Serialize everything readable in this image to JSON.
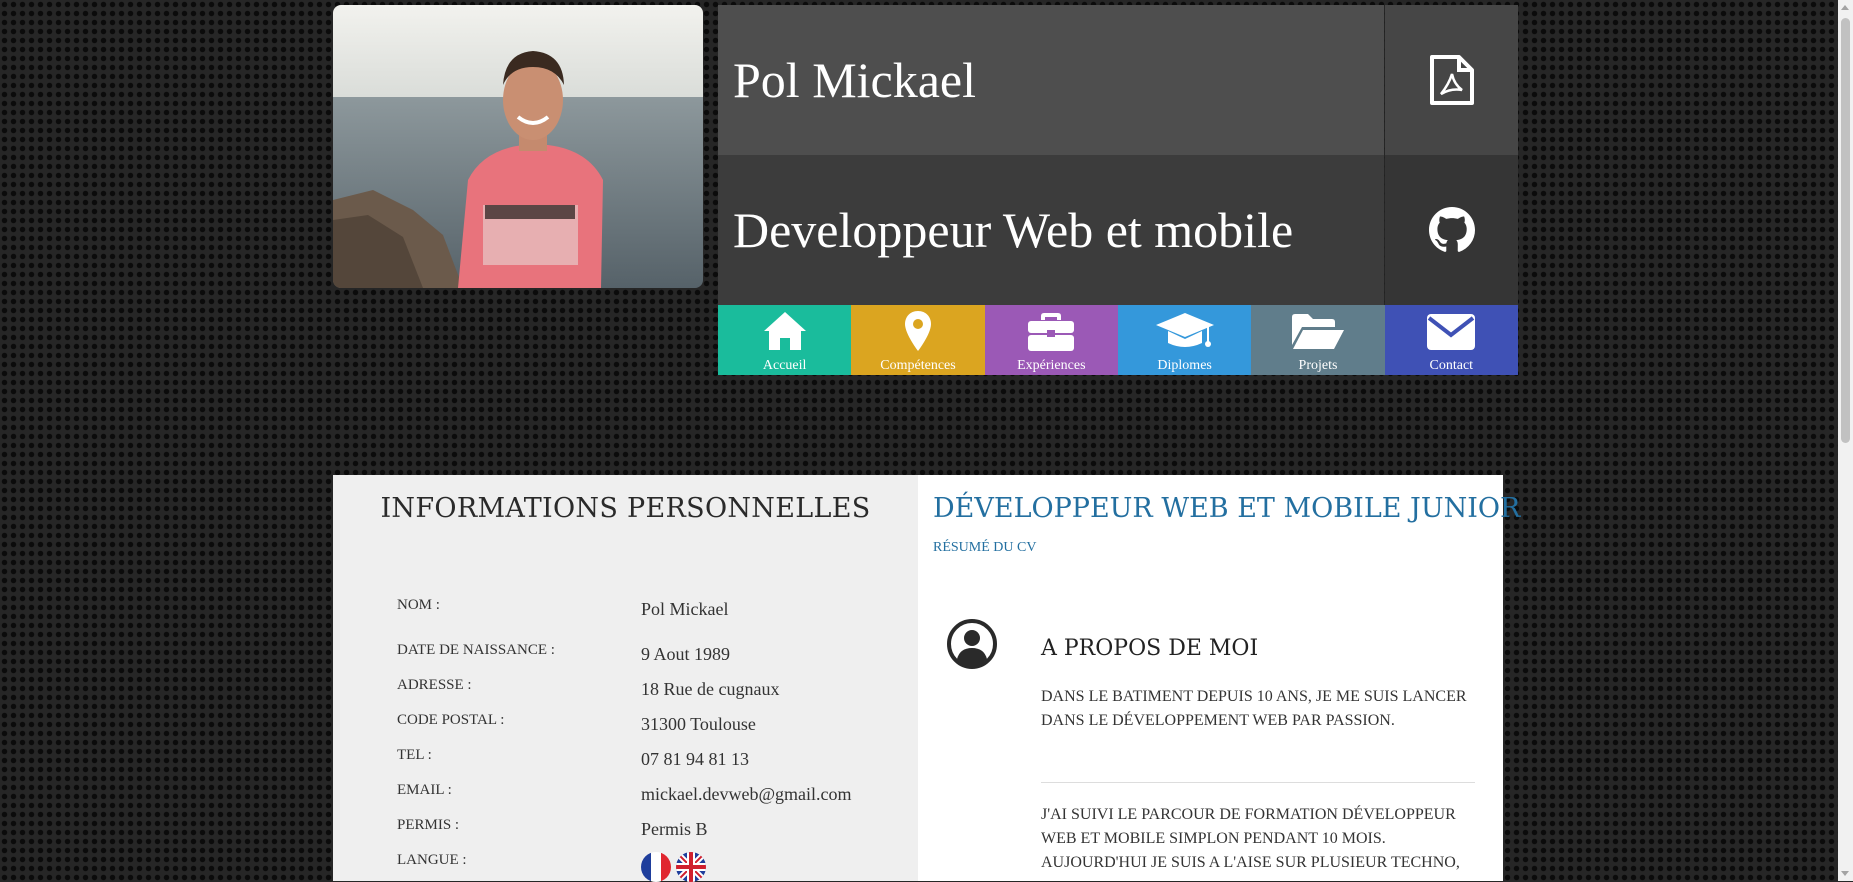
{
  "header": {
    "name": "Pol Mickael",
    "title": "Developpeur Web et mobile",
    "pdf_icon": "pdf-file-icon",
    "github_icon": "github-icon"
  },
  "nav": {
    "items": [
      {
        "label": "Accueil",
        "icon": "home-icon",
        "color": "#1abc9c"
      },
      {
        "label": "Compétences",
        "icon": "map-marker-icon",
        "color": "#dba520"
      },
      {
        "label": "Expériences",
        "icon": "briefcase-icon",
        "color": "#9b59b6"
      },
      {
        "label": "Diplomes",
        "icon": "graduation-cap-icon",
        "color": "#3498db"
      },
      {
        "label": "Projets",
        "icon": "folder-open-icon",
        "color": "#607d8b"
      },
      {
        "label": "Contact",
        "icon": "envelope-icon",
        "color": "#3f51b5"
      }
    ]
  },
  "personal": {
    "heading": "INFORMATIONS PERSONNELLES",
    "rows": [
      {
        "label": "NOM :",
        "value": "Pol Mickael"
      },
      {
        "label": "DATE DE NAISSANCE :",
        "value": "9 Aout 1989"
      },
      {
        "label": "ADRESSE :",
        "value": "18 Rue de cugnaux"
      },
      {
        "label": "CODE POSTAL :",
        "value": "31300 Toulouse"
      },
      {
        "label": "TEL :",
        "value": "07 81 94 81 13"
      },
      {
        "label": "EMAIL :",
        "value": "mickael.devweb@gmail.com"
      },
      {
        "label": "PERMIS :",
        "value": "Permis B"
      },
      {
        "label": "LANGUE :",
        "value": ""
      }
    ],
    "languages": [
      "french-flag-icon",
      "uk-flag-icon"
    ]
  },
  "resume": {
    "heading": "DÉVELOPPEUR WEB ET MOBILE JUNIOR",
    "subtitle": "RÉSUMÉ DU CV",
    "about_title": "A PROPOS DE MOI",
    "about_icon": "user-circle-icon",
    "para1": "DANS LE BATIMENT DEPUIS 10 ANS, JE ME SUIS LANCER DANS LE DÉVELOPPEMENT WEB PAR PASSION.",
    "para2": "J'AI SUIVI LE PARCOUR DE FORMATION DÉVELOPPEUR WEB ET MOBILE SIMPLON PENDANT 10 MOIS. AUJOURD'HUI JE SUIS A L'AISE SUR PLUSIEUR TECHNO,"
  },
  "colors": {
    "accent": "#236fa0",
    "background": "#262626"
  }
}
